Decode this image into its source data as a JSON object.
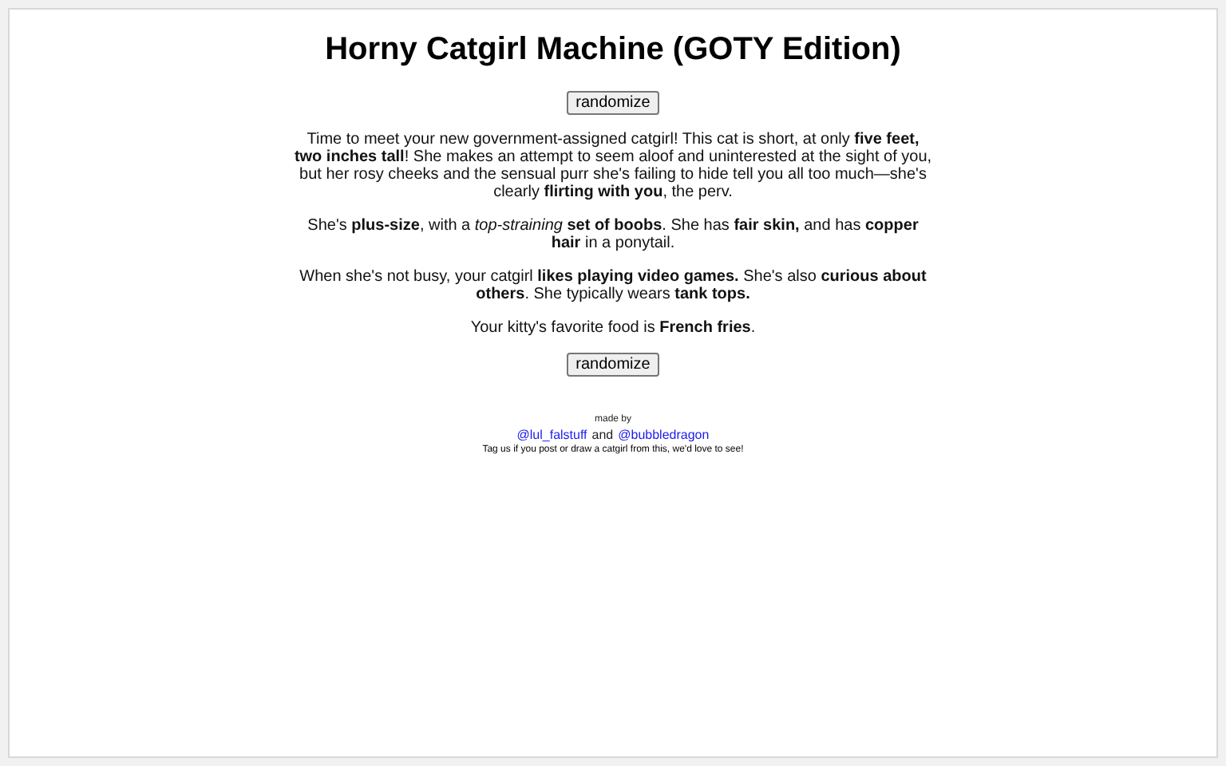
{
  "title": "Horny Catgirl Machine (GOTY Edition)",
  "top_button": "randomize",
  "paragraphs": [
    "Time to meet your new government-assigned catgirl! This cat is short, at only **five feet, two inches tall**! She makes an attempt to seem aloof and uninterested at the sight of you, but her rosy cheeks and the sensual purr she's failing to hide tell you all too much—she's clearly **flirting with you**, the perv.",
    "She's **plus-size**, with a *top-straining* **set of boobs**. She has **fair skin,** and has **copper hair** in a ponytail.",
    "When she's not busy, your catgirl **likes playing video games.** She's also **curious about others**. She typically wears **tank tops.**",
    "Your kitty's favorite food is **French fries**."
  ],
  "bottom_button": "randomize",
  "footer": {
    "made_by": "made by",
    "links": [
      "@lul_falstuff",
      "@bubbledragon"
    ],
    "conjunction": "and",
    "note": "Tag us if you post or draw a catgirl from this, we'd love to see!"
  }
}
